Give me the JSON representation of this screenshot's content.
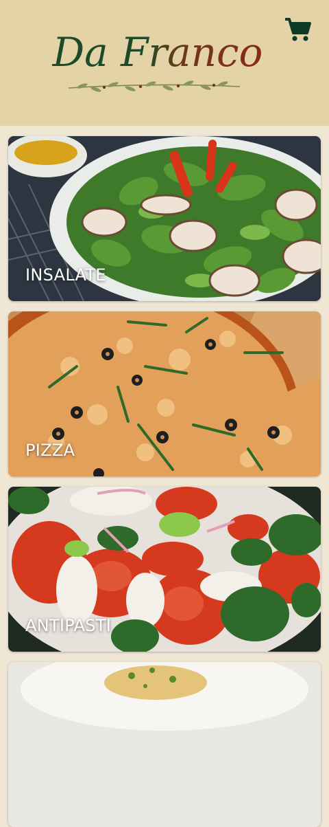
{
  "app": {
    "brand_title": "Da Franco",
    "cart_icon": "shopping-cart-icon"
  },
  "colors": {
    "header_bg": "#e3d3a6",
    "page_bg": "#efe6d4",
    "brand_green": "#1f4a2a",
    "brand_red": "#8a2a18",
    "label_text": "#ffffff"
  },
  "categories": [
    {
      "label": "INSALATE",
      "image": "salad-photo"
    },
    {
      "label": "PIZZA",
      "image": "pizza-photo"
    },
    {
      "label": "ANTIPASTI",
      "image": "caprese-salad-photo"
    },
    {
      "label": "",
      "image": "pasta-dish-photo"
    }
  ]
}
